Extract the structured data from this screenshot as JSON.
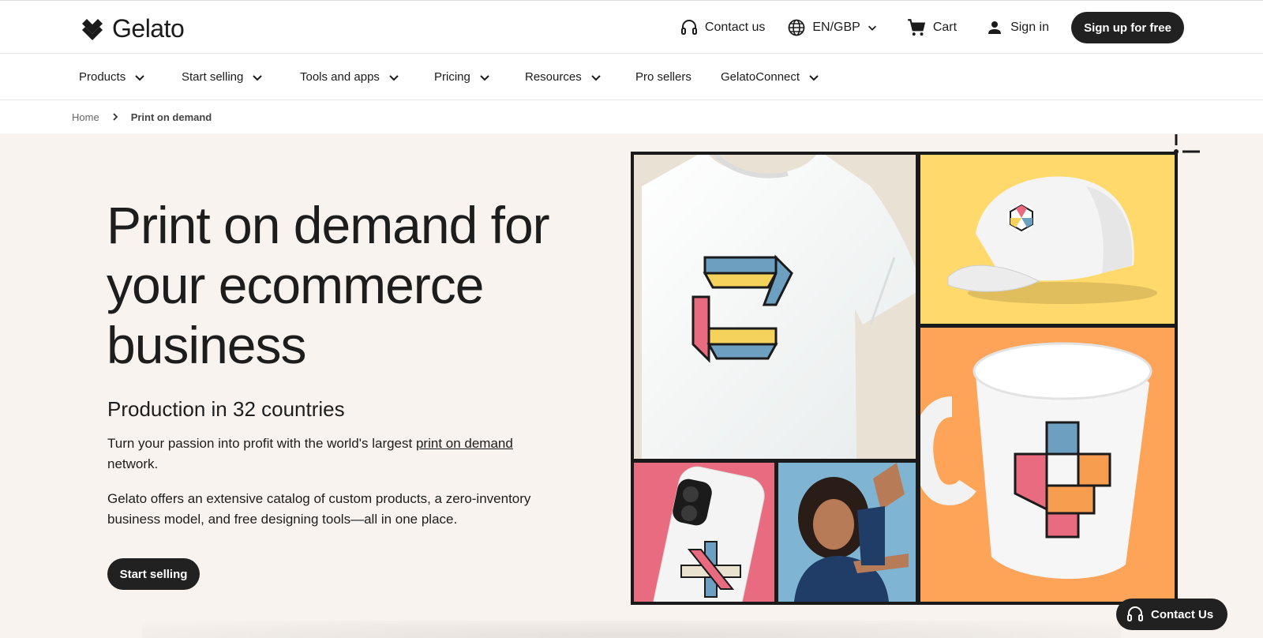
{
  "brand": {
    "name": "Gelato"
  },
  "header": {
    "contact_label": "Contact us",
    "language_label": "EN/GBP",
    "cart_label": "Cart",
    "signin_label": "Sign in",
    "signup_label": "Sign up for free"
  },
  "nav": {
    "items": [
      {
        "label": "Products",
        "dropdown": true
      },
      {
        "label": "Start selling",
        "dropdown": true
      },
      {
        "label": "Tools and apps",
        "dropdown": true
      },
      {
        "label": "Pricing",
        "dropdown": true
      },
      {
        "label": "Resources",
        "dropdown": true
      },
      {
        "label": "Pro sellers",
        "dropdown": false
      },
      {
        "label": "GelatoConnect",
        "dropdown": true
      }
    ]
  },
  "breadcrumb": {
    "home": "Home",
    "current": "Print on demand"
  },
  "hero": {
    "title": "Print on demand for your ecommerce business",
    "subtitle": "Production in 32 countries",
    "para1_before": "Turn your passion into profit with the world's largest ",
    "para1_link": "print on demand",
    "para1_after": " network.",
    "para2": "Gelato offers an extensive catalog of custom products, a zero-inventory business model, and free designing tools—all in one place.",
    "cta_label": "Start selling"
  },
  "floating": {
    "contact_label": "Contact Us"
  },
  "colors": {
    "dark": "#212121",
    "hero_bg": "#f8f3ee",
    "panel_yellow": "#ffd96b",
    "panel_orange": "#fda459",
    "panel_pink": "#e86b80",
    "panel_blue": "#7fb5d2",
    "panel_beige": "#e9e2d4"
  },
  "icons": [
    "gelato-logo-icon",
    "headset-icon",
    "globe-icon",
    "chevron-down-icon",
    "cart-icon",
    "user-icon",
    "chevron-right-icon"
  ]
}
